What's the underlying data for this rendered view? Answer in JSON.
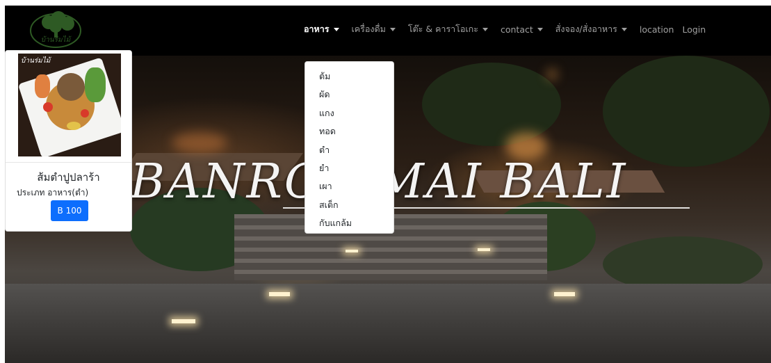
{
  "brand": {
    "logo_text": "บ้านร่มไม้"
  },
  "nav": {
    "items": [
      {
        "label": "อาหาร",
        "dropdown": true,
        "active": true
      },
      {
        "label": "เครื่องดื่ม",
        "dropdown": true
      },
      {
        "label": "โต๊ะ & คาราโอเกะ",
        "dropdown": true
      },
      {
        "label": "contact",
        "dropdown": true
      },
      {
        "label": "สั่งจอง/สั่งอาหาร",
        "dropdown": true
      },
      {
        "label": "location",
        "dropdown": false
      },
      {
        "label": "Login",
        "dropdown": false
      }
    ]
  },
  "dropdown": {
    "items": [
      "ต้ม",
      "ผัด",
      "แกง",
      "ทอด",
      "ตำ",
      "ยำ",
      "เผา",
      "สเต็ก",
      "กับแกล้ม"
    ]
  },
  "hero": {
    "title": "BANROMMAI BALI"
  },
  "card": {
    "image_caption": "บ้านร่มไม้",
    "title": "ส้มตำปูปลาร้า",
    "type_text": "ประเภท อาหาร(ตำ)",
    "price_label": "B 100"
  },
  "colors": {
    "navbar": "#000000",
    "primary_button": "#0d6efd",
    "brand_green": "#2e5a24"
  }
}
